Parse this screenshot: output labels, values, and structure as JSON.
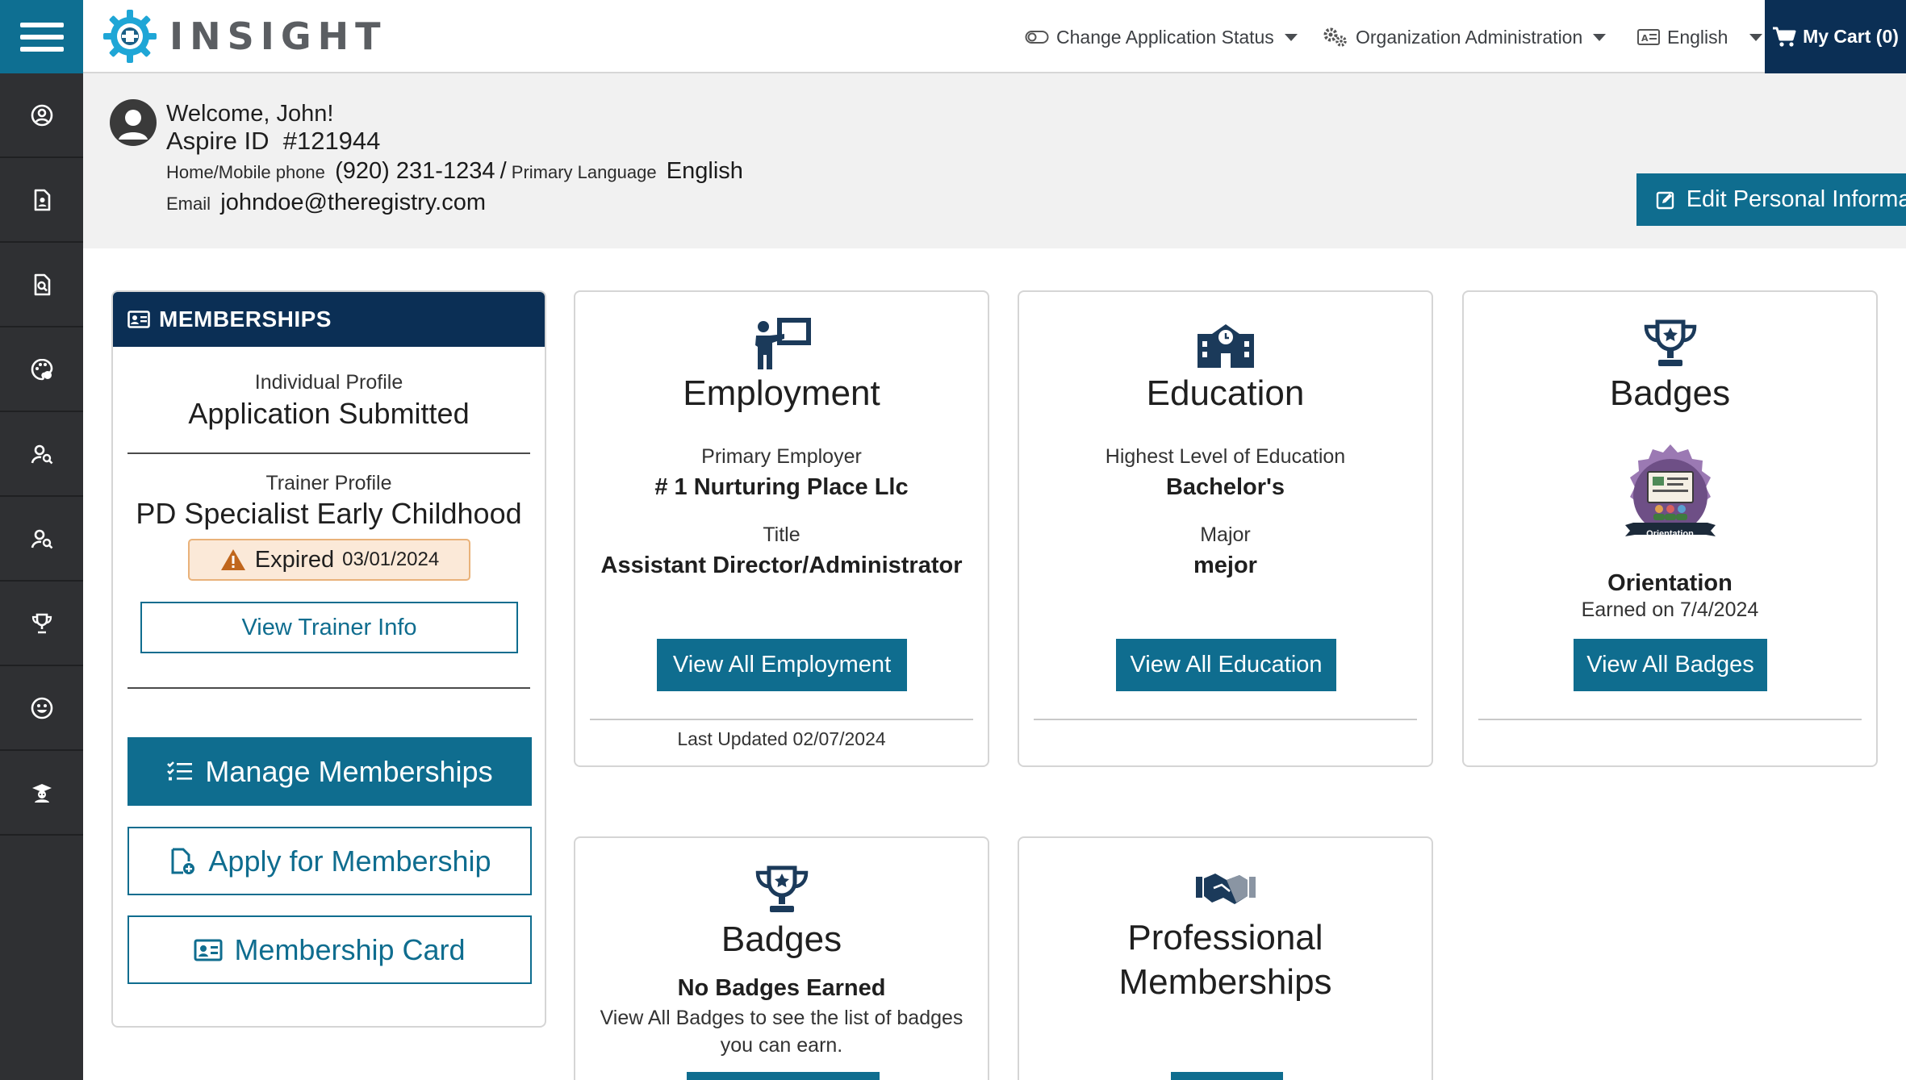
{
  "app": {
    "brand": "INSIGHT"
  },
  "topnav": {
    "app_status": "Change Application Status",
    "org_admin": "Organization Administration",
    "language": "English",
    "cart": "My Cart (0)"
  },
  "sidebar": {
    "items": [
      {
        "icon": "user-circle-icon"
      },
      {
        "icon": "document-user-icon"
      },
      {
        "icon": "document-search-icon"
      },
      {
        "icon": "palette-icon"
      },
      {
        "icon": "user-search-icon"
      },
      {
        "icon": "user-search-icon"
      },
      {
        "icon": "trophy-icon"
      },
      {
        "icon": "smiley-icon"
      },
      {
        "icon": "teacher-icon"
      }
    ]
  },
  "welcome": {
    "greeting": "Welcome, John!",
    "aspire_label": "Aspire ID",
    "aspire_id": "#121944",
    "phone_label": "Home/Mobile phone",
    "phone": "(920) 231-1234",
    "separator": "/",
    "language_label": "Primary Language",
    "language": "English",
    "email_label": "Email",
    "email": "johndoe@theregistry.com",
    "edit_button": "Edit Personal Information"
  },
  "memberships": {
    "heading": "MEMBERSHIPS",
    "individual_label": "Individual Profile",
    "individual_status": "Application Submitted",
    "trainer_label": "Trainer Profile",
    "trainer_title": "PD Specialist Early Childhood",
    "expired_label": "Expired",
    "expired_date": "03/01/2024",
    "view_trainer_button": "View Trainer Info",
    "manage_button": "Manage Memberships",
    "apply_button": "Apply for Membership",
    "card_button": "Membership Card"
  },
  "employment": {
    "title": "Employment",
    "employer_label": "Primary Employer",
    "employer": "# 1 Nurturing Place Llc",
    "title_label": "Title",
    "job_title": "Assistant Director/Administrator",
    "button": "View All Employment",
    "last_updated": "Last Updated 02/07/2024"
  },
  "education": {
    "title": "Education",
    "level_label": "Highest Level of Education",
    "level": "Bachelor's",
    "major_label": "Major",
    "major": "mejor",
    "button": "View All Education"
  },
  "badges": {
    "title": "Badges",
    "badge_ribbon": "Orientation",
    "badge_name": "Orientation",
    "earned": "Earned on 7/4/2024",
    "button": "View All Badges"
  },
  "badges2": {
    "title": "Badges",
    "none": "No Badges Earned",
    "hint": "View All Badges to see the list of badges you can earn."
  },
  "professional": {
    "title": "Professional Memberships"
  },
  "colors": {
    "primary": "#0f6d8f",
    "navy": "#0b2f55",
    "sidebar": "#2f3033",
    "badge_purple": "#7a5a92",
    "warning": "#c0661c"
  }
}
